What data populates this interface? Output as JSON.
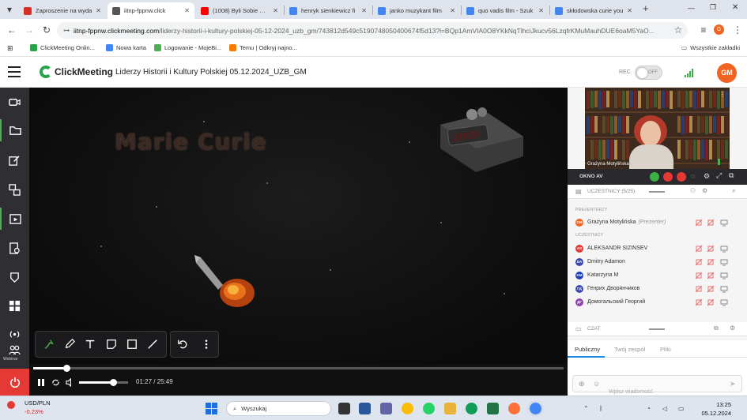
{
  "browser": {
    "tabs": [
      {
        "title": "Zaproszenie na wyda",
        "fav_color": "#d93025"
      },
      {
        "title": "iitnp-fppnw.click",
        "fav_color": "#555555",
        "active": true
      },
      {
        "title": "(1008) Byli Sobie Wyn",
        "fav_color": "#ff0000"
      },
      {
        "title": "henryk sienkiewicz fi",
        "fav_color": "#4285f4"
      },
      {
        "title": "janko muzykant film",
        "fav_color": "#4285f4"
      },
      {
        "title": "quo vadis film - Szuk",
        "fav_color": "#4285f4"
      },
      {
        "title": "skłodowska curie you",
        "fav_color": "#4285f4"
      }
    ],
    "new_tab": "+",
    "url_host": "iitnp-fppnw.clickmeeting.com",
    "url_path": "/liderzy-historii-i-kultury-polskiej-05-12-2024_uzb_gm/743812d549c5190748050400674f5d13?l=BQp1AmVIA0O8YKkNqTlhciJkucv56LzqfrKMuMauhDUE6oaM5YaO...",
    "profile_initial": "G",
    "bookmarks": [
      {
        "label": "ClickMeeting Onlin...",
        "color": "#2aa24a"
      },
      {
        "label": "Nowa karta",
        "color": "#4285f4"
      },
      {
        "label": "Logowanie - MojeBi...",
        "color": "#4caf50"
      },
      {
        "label": "Temu | Odkryj najno...",
        "color": "#f57c00"
      }
    ],
    "all_bookmarks": "Wszystkie zakładki"
  },
  "app": {
    "logo": "ClickMeeting",
    "room_title": "Liderzy Historii i Kultury Polskiej 05.12.2024_UZB_GM",
    "rec_label": "REC",
    "rec_state": "OFF",
    "user_initials": "GM",
    "accent": "#f26322"
  },
  "rail": {
    "items": [
      "video-icon",
      "folder-icon",
      "edit-icon",
      "screenshare-icon",
      "media-icon",
      "tests-icon",
      "cast-icon",
      "apps-icon",
      "broadcast-icon",
      "webinar-icon"
    ],
    "webinar_label": "Webinar",
    "active_index": 4
  },
  "stage": {
    "slide_text": "Marie Curie",
    "progress_fraction": 0.062,
    "volume_fraction": 0.7,
    "timecode": "01:27 / 25:49"
  },
  "panel": {
    "cam_person": "Grażyna Motylińska",
    "okno_label": "OKNO AV",
    "participants_header": "UCZESTNICY (5/25)",
    "presenters_label": "PREZENTERZY",
    "participants_label": "UCZESTNICY",
    "presenters": [
      {
        "initials": "GM",
        "name": "Grażyna Motylińska",
        "role": "(Prezenter)",
        "color": "#f26322"
      }
    ],
    "participants": [
      {
        "initials": "AS",
        "name": "ALEKSANDR SIZINSEV",
        "color": "#e53935"
      },
      {
        "initials": "DA",
        "name": "Dmitry Adamon",
        "color": "#3949ab"
      },
      {
        "initials": "KM",
        "name": "Katarzyna M",
        "color": "#1e40af"
      },
      {
        "initials": "ГД",
        "name": "Генрих Дворянчиков",
        "color": "#3949ab"
      },
      {
        "initials": "ДГ",
        "name": "Домогальский Георгий",
        "color": "#8e44ad"
      }
    ],
    "chat_header": "CZAT",
    "chat_tabs": [
      "Publiczny",
      "Twój zespół",
      "Pliki"
    ],
    "chat_placeholder": "Wpisz wiadomość"
  },
  "taskbar": {
    "ticker_name": "USD/PLN",
    "ticker_delta": "-0.23%",
    "search_placeholder": "Wyszukaj",
    "time": "13:25",
    "date": "05.12.2024"
  }
}
